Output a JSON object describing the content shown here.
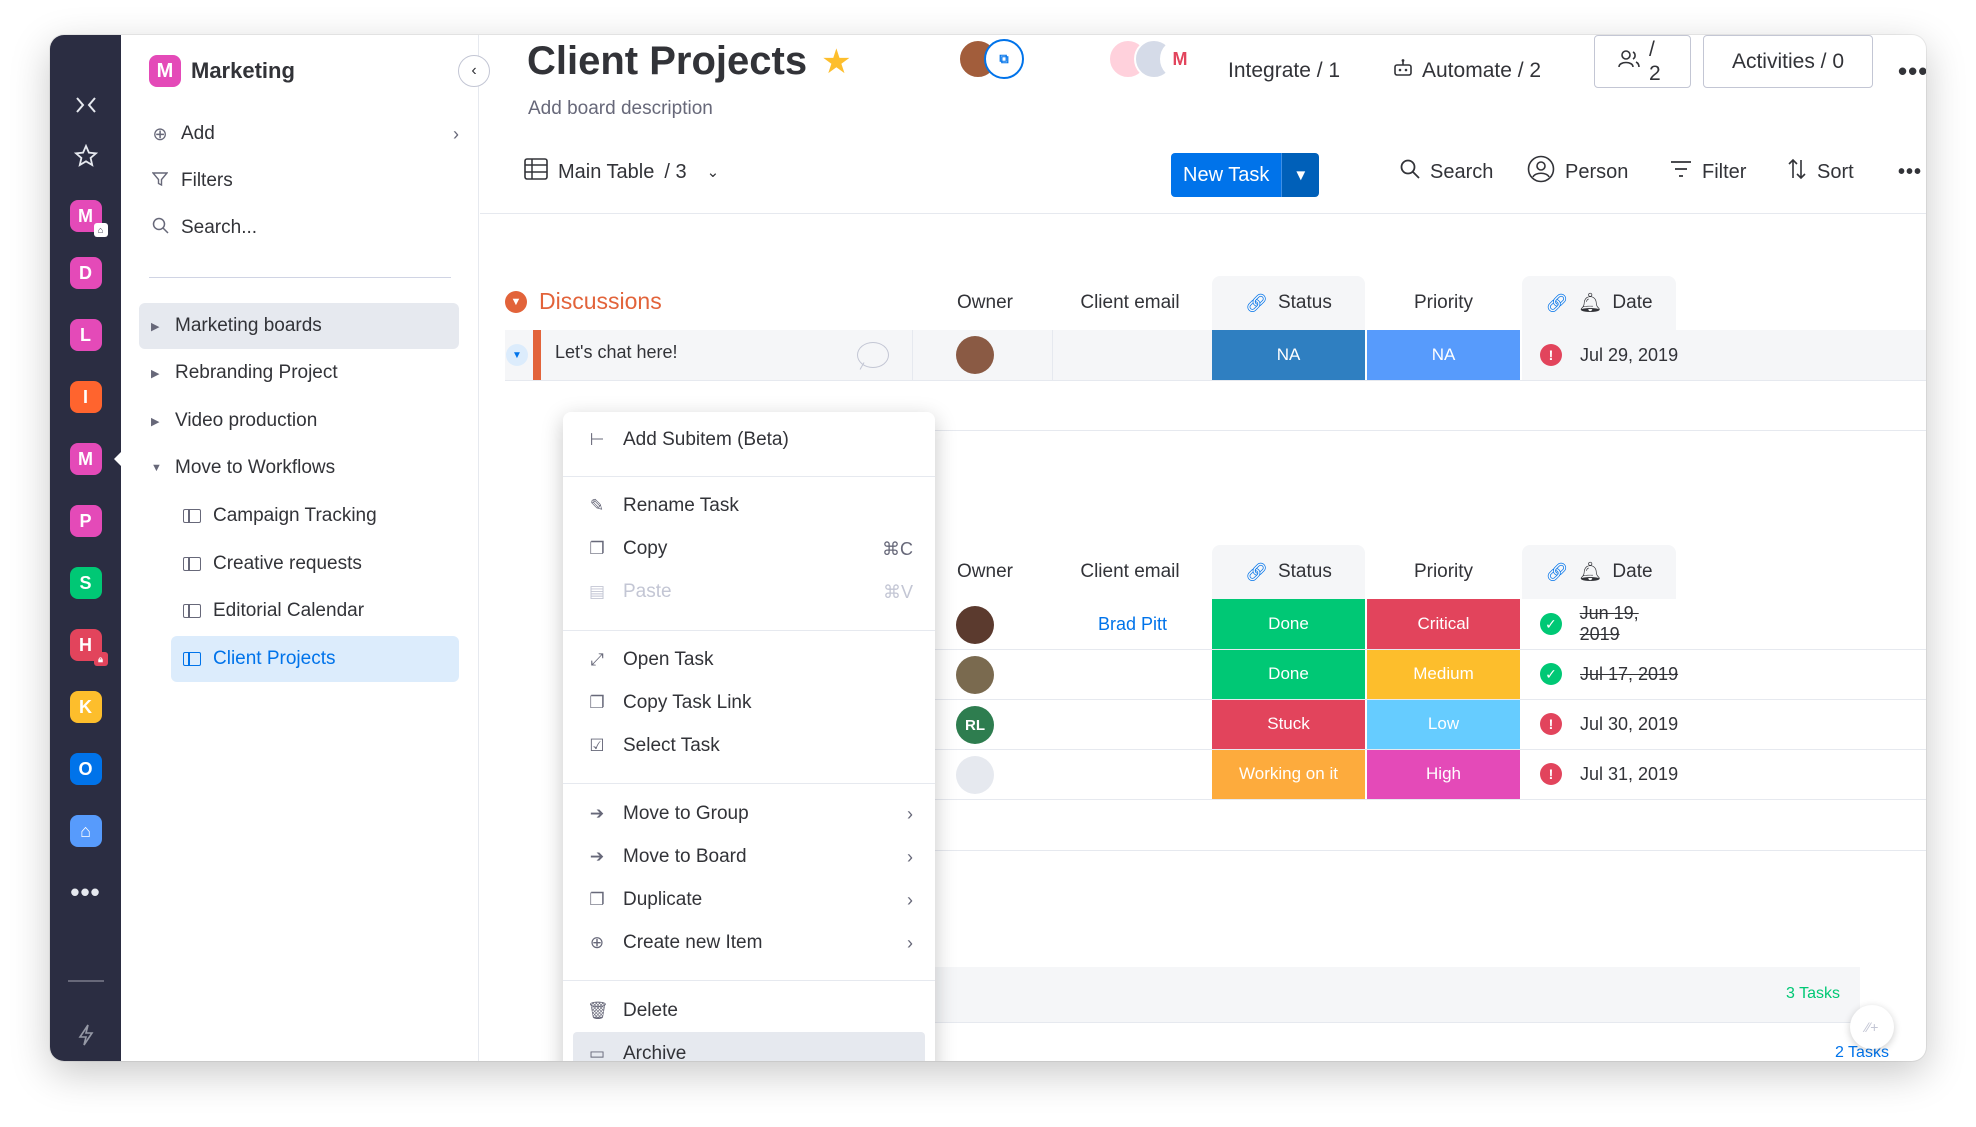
{
  "workspace": {
    "badge": "M",
    "name": "Marketing"
  },
  "rail": {
    "workspaces": [
      {
        "letter": "M",
        "color": "#e44ab8"
      },
      {
        "letter": "D",
        "color": "#e44ab8"
      },
      {
        "letter": "L",
        "color": "#e44ab8"
      },
      {
        "letter": "I",
        "color": "#ff642e"
      },
      {
        "letter": "M",
        "color": "#e44ab8"
      },
      {
        "letter": "P",
        "color": "#e44ab8"
      },
      {
        "letter": "S",
        "color": "#00c875"
      },
      {
        "letter": "H",
        "color": "#e2445c"
      },
      {
        "letter": "K",
        "color": "#fdbe2c"
      },
      {
        "letter": "O",
        "color": "#0073ea"
      },
      {
        "letter": "⌂",
        "color": "#579bfc"
      }
    ]
  },
  "sidebar": {
    "add_label": "Add",
    "filters_label": "Filters",
    "search_label": "Search...",
    "folders": [
      {
        "label": "Marketing boards"
      },
      {
        "label": "Rebranding Project"
      },
      {
        "label": "Video production"
      },
      {
        "label": "Move to Workflows"
      }
    ],
    "boards": [
      {
        "label": "Campaign Tracking"
      },
      {
        "label": "Creative requests"
      },
      {
        "label": "Editorial Calendar"
      },
      {
        "label": "Client Projects"
      }
    ]
  },
  "header": {
    "title": "Client Projects",
    "description": "Add board description",
    "integrate_label": "Integrate / 1",
    "automate_label": "Automate / 2",
    "members_label": "/ 2",
    "activities_label": "Activities / 0"
  },
  "toolbar": {
    "view_label": "Main Table",
    "view_count": "/ 3",
    "new_task_label": "New Task",
    "search_label": "Search",
    "person_label": "Person",
    "filter_label": "Filter",
    "sort_label": "Sort"
  },
  "columns": {
    "owner": "Owner",
    "client_email": "Client email",
    "status": "Status",
    "priority": "Priority",
    "date": "Date"
  },
  "group1": {
    "title": "Discussions",
    "row": {
      "name": "Let's chat here!",
      "status": "NA",
      "status_color": "#2f7fc1",
      "priority": "NA",
      "priority_color": "#579bfc",
      "date": "Jul 29, 2019"
    }
  },
  "group2": {
    "rows": [
      {
        "email": "Brad Pitt",
        "status": "Done",
        "status_color": "#00c875",
        "priority": "Critical",
        "priority_color": "#e2445c",
        "date": "Jun 19, 2019",
        "done": true
      },
      {
        "email": "",
        "status": "Done",
        "status_color": "#00c875",
        "priority": "Medium",
        "priority_color": "#fdbe2c",
        "date": "Jul 17, 2019",
        "done": true
      },
      {
        "email": "",
        "owner_initials": "RL",
        "status": "Stuck",
        "status_color": "#e2445c",
        "priority": "Low",
        "priority_color": "#66ccff",
        "date": "Jul 30, 2019",
        "done": false
      },
      {
        "email": "",
        "status": "Working on it",
        "status_color": "#fdab3d",
        "priority": "High",
        "priority_color": "#e44ab8",
        "date": "Jul 31, 2019",
        "done": false
      }
    ]
  },
  "footers": {
    "tasks_a": "3 Tasks",
    "tasks_b": "2 Tasks",
    "tasks_color": "#00c875"
  },
  "context_menu": {
    "add_subitem": "Add Subitem (Beta)",
    "rename": "Rename Task",
    "copy": "Copy",
    "copy_shortcut": "⌘C",
    "paste": "Paste",
    "paste_shortcut": "⌘V",
    "open": "Open Task",
    "copy_link": "Copy Task Link",
    "select": "Select Task",
    "move_group": "Move to Group",
    "move_board": "Move to Board",
    "duplicate": "Duplicate",
    "create_new": "Create new Item",
    "delete": "Delete",
    "archive": "Archive"
  }
}
